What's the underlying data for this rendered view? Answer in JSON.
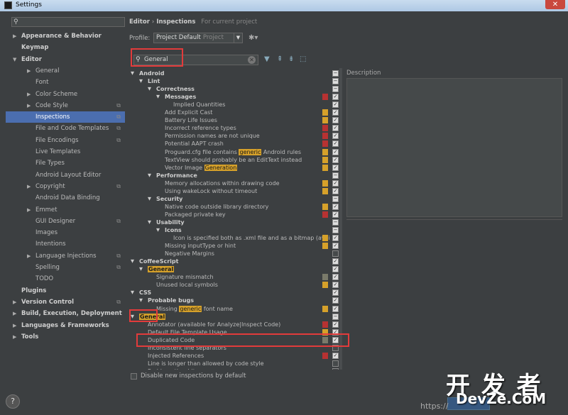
{
  "window": {
    "title": "Settings",
    "close": "✕"
  },
  "left_search": {
    "icon": "search-icon",
    "value": ""
  },
  "sidebar": [
    {
      "label": "Appearance & Behavior",
      "level": 0,
      "arrow": "▶",
      "bold": true,
      "copy": false
    },
    {
      "label": "Keymap",
      "level": 0,
      "arrow": "",
      "bold": true,
      "copy": false
    },
    {
      "label": "Editor",
      "level": 0,
      "arrow": "▼",
      "bold": true,
      "copy": false
    },
    {
      "label": "General",
      "level": 1,
      "arrow": "▶",
      "copy": false
    },
    {
      "label": "Font",
      "level": 1,
      "arrow": "",
      "copy": false
    },
    {
      "label": "Color Scheme",
      "level": 1,
      "arrow": "▶",
      "copy": false
    },
    {
      "label": "Code Style",
      "level": 1,
      "arrow": "▶",
      "copy": true
    },
    {
      "label": "Inspections",
      "level": 1,
      "arrow": "",
      "copy": true,
      "selected": true
    },
    {
      "label": "File and Code Templates",
      "level": 1,
      "arrow": "",
      "copy": true
    },
    {
      "label": "File Encodings",
      "level": 1,
      "arrow": "",
      "copy": true
    },
    {
      "label": "Live Templates",
      "level": 1,
      "arrow": "",
      "copy": false
    },
    {
      "label": "File Types",
      "level": 1,
      "arrow": "",
      "copy": false
    },
    {
      "label": "Android Layout Editor",
      "level": 1,
      "arrow": "",
      "copy": false
    },
    {
      "label": "Copyright",
      "level": 1,
      "arrow": "▶",
      "copy": true
    },
    {
      "label": "Android Data Binding",
      "level": 1,
      "arrow": "",
      "copy": false
    },
    {
      "label": "Emmet",
      "level": 1,
      "arrow": "▶",
      "copy": false
    },
    {
      "label": "GUI Designer",
      "level": 1,
      "arrow": "",
      "copy": true
    },
    {
      "label": "Images",
      "level": 1,
      "arrow": "",
      "copy": false
    },
    {
      "label": "Intentions",
      "level": 1,
      "arrow": "",
      "copy": false
    },
    {
      "label": "Language Injections",
      "level": 1,
      "arrow": "▶",
      "copy": true
    },
    {
      "label": "Spelling",
      "level": 1,
      "arrow": "",
      "copy": true
    },
    {
      "label": "TODO",
      "level": 1,
      "arrow": "",
      "copy": false
    },
    {
      "label": "Plugins",
      "level": 0,
      "arrow": "",
      "bold": true,
      "copy": false
    },
    {
      "label": "Version Control",
      "level": 0,
      "arrow": "▶",
      "bold": true,
      "copy": true
    },
    {
      "label": "Build, Execution, Deployment",
      "level": 0,
      "arrow": "▶",
      "bold": true,
      "copy": false
    },
    {
      "label": "Languages & Frameworks",
      "level": 0,
      "arrow": "▶",
      "bold": true,
      "copy": false
    },
    {
      "label": "Tools",
      "level": 0,
      "arrow": "▶",
      "bold": true,
      "copy": false
    }
  ],
  "breadcrumb": {
    "part1": "Editor",
    "sep": "›",
    "part2": "Inspections",
    "hint": "For current project"
  },
  "profile": {
    "label": "Profile:",
    "value": "Project Default",
    "ghost": "Project"
  },
  "search": {
    "value": "General"
  },
  "description_label": "Description",
  "inspections": [
    {
      "t": "Android",
      "l": 0,
      "a": "▼",
      "b": true,
      "sev": "",
      "cb": "dash"
    },
    {
      "t": "Lint",
      "l": 1,
      "a": "▼",
      "b": true,
      "sev": "",
      "cb": "dash"
    },
    {
      "t": "Correctness",
      "l": 2,
      "a": "▼",
      "b": true,
      "sev": "",
      "cb": "dash"
    },
    {
      "t": "Messages",
      "l": 3,
      "a": "▼",
      "b": true,
      "sev": "#b73232",
      "cb": "check"
    },
    {
      "t": "Implied Quantities",
      "l": 4,
      "a": "",
      "sev": "",
      "cb": "check"
    },
    {
      "t": "Add Explicit Cast",
      "l": 3,
      "a": "",
      "sev": "#d6a12a",
      "cb": "check"
    },
    {
      "t": "Battery Life Issues",
      "l": 3,
      "a": "",
      "sev": "#d6a12a",
      "cb": "check"
    },
    {
      "t": "Incorrect reference types",
      "l": 3,
      "a": "",
      "sev": "#b73232",
      "cb": "check"
    },
    {
      "t": "Permission names are not unique",
      "l": 3,
      "a": "",
      "sev": "#b73232",
      "cb": "check"
    },
    {
      "t": "Potential AAPT crash",
      "l": 3,
      "a": "",
      "sev": "#b73232",
      "cb": "check"
    },
    {
      "t": "Proguard.cfg file contains ",
      "hl": "generic",
      "after": " Android rules",
      "l": 3,
      "a": "",
      "sev": "#d6a12a",
      "cb": "check"
    },
    {
      "t": "TextView should probably be an EditText instead",
      "l": 3,
      "a": "",
      "sev": "#d6a12a",
      "cb": "check"
    },
    {
      "t": "Vector Image ",
      "hl": "Generation",
      "after": "",
      "l": 3,
      "a": "",
      "sev": "#d6a12a",
      "cb": "check"
    },
    {
      "t": "Performance",
      "l": 2,
      "a": "▼",
      "b": true,
      "sev": "",
      "cb": "dash"
    },
    {
      "t": "Memory allocations within drawing code",
      "l": 3,
      "a": "",
      "sev": "#d6a12a",
      "cb": "check"
    },
    {
      "t": "Using wakeLock without timeout",
      "l": 3,
      "a": "",
      "sev": "#d6a12a",
      "cb": "check"
    },
    {
      "t": "Security",
      "l": 2,
      "a": "▼",
      "b": true,
      "sev": "",
      "cb": "dash"
    },
    {
      "t": "Native code outside library directory",
      "l": 3,
      "a": "",
      "sev": "#d6a12a",
      "cb": "check"
    },
    {
      "t": "Packaged private key",
      "l": 3,
      "a": "",
      "sev": "#b73232",
      "cb": "check"
    },
    {
      "t": "Usability",
      "l": 2,
      "a": "▼",
      "b": true,
      "sev": "",
      "cb": "dash"
    },
    {
      "t": "Icons",
      "l": 3,
      "a": "▼",
      "b": true,
      "sev": "",
      "cb": "dash"
    },
    {
      "t": "Icon is specified both as .xml file and as a bitmap (avai",
      "l": 4,
      "a": "",
      "sev": "#d6a12a",
      "cb": "check"
    },
    {
      "t": "Missing inputType or hint",
      "l": 3,
      "a": "",
      "sev": "#d6a12a",
      "cb": "check"
    },
    {
      "t": "Negative Margins",
      "l": 3,
      "a": "",
      "sev": "",
      "cb": "empty"
    },
    {
      "t": "CoffeeScript",
      "l": 0,
      "a": "▼",
      "b": true,
      "sev": "",
      "cb": "check"
    },
    {
      "t": "",
      "hl": "General",
      "after": "",
      "l": 1,
      "a": "▼",
      "b": true,
      "sev": "",
      "cb": "check"
    },
    {
      "t": "Signature mismatch",
      "l": 2,
      "a": "",
      "sev": "#7a7a6a",
      "cb": "check"
    },
    {
      "t": "Unused local symbols",
      "l": 2,
      "a": "",
      "sev": "#d6a12a",
      "cb": "check"
    },
    {
      "t": "CSS",
      "l": 0,
      "a": "▼",
      "b": true,
      "sev": "",
      "cb": "check"
    },
    {
      "t": "Probable bugs",
      "l": 1,
      "a": "▼",
      "b": true,
      "sev": "",
      "cb": "check"
    },
    {
      "t": "Missing ",
      "hl": "generic",
      "after": " font name",
      "l": 2,
      "a": "",
      "sev": "#d6a12a",
      "cb": "check"
    },
    {
      "t": "",
      "hl": "General",
      "after": "",
      "l": 0,
      "a": "▼",
      "b": true,
      "sev": "",
      "cb": "dash"
    },
    {
      "t": "Annotator (available for Analyze|Inspect Code)",
      "l": 1,
      "a": "",
      "sev": "#b73232",
      "cb": "check"
    },
    {
      "t": "Default File Template Usage",
      "l": 1,
      "a": "",
      "sev": "#d6a12a",
      "cb": "check"
    },
    {
      "t": "Duplicated Code",
      "l": 1,
      "a": "",
      "sev": "#7a7a6a",
      "cb": "check"
    },
    {
      "t": "Inconsistent line separators",
      "l": 1,
      "a": "",
      "sev": "",
      "cb": "empty"
    },
    {
      "t": "Injected References",
      "l": 1,
      "a": "",
      "sev": "#b73232",
      "cb": "check"
    },
    {
      "t": "Line is longer than allowed by code style",
      "l": 1,
      "a": "",
      "sev": "",
      "cb": "empty"
    },
    {
      "t": "Problematic whitespace",
      "l": 1,
      "a": "",
      "sev": "",
      "cb": "empty"
    }
  ],
  "bottom": {
    "disable_new_label": "Disable new inspections by default",
    "help": "?"
  },
  "watermark": {
    "big": "开 发 者",
    "sub": "DevZe.CoM",
    "url": "https://"
  }
}
